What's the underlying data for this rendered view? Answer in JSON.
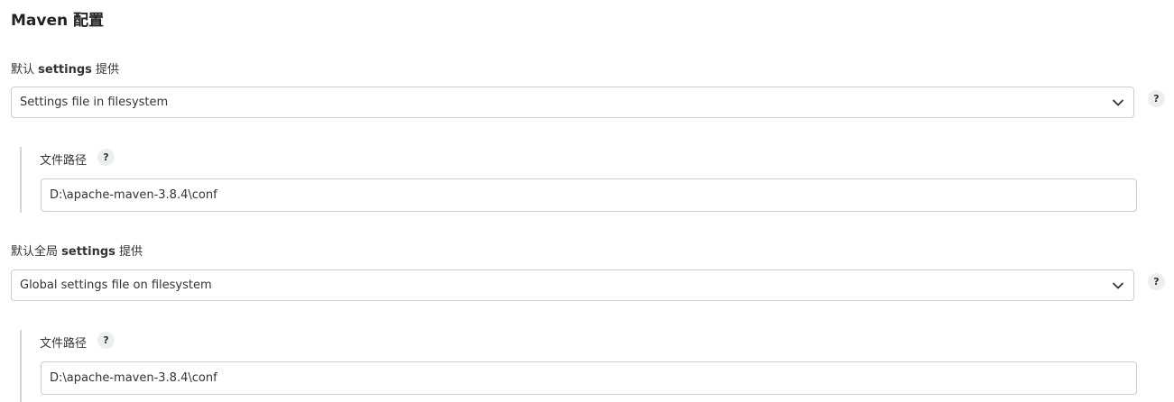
{
  "section": {
    "title": "Maven 配置"
  },
  "settings": {
    "label_prefix": "默认 ",
    "label_bold": "settings",
    "label_suffix": " 提供",
    "selected": "Settings file in filesystem",
    "help_text": "?",
    "file_path": {
      "label": "文件路径",
      "help_text": "?",
      "value": "D:\\apache-maven-3.8.4\\conf"
    }
  },
  "global_settings": {
    "label_prefix": "默认全局 ",
    "label_bold": "settings",
    "label_suffix": " 提供",
    "selected": "Global settings file on filesystem",
    "help_text": "?",
    "file_path": {
      "label": "文件路径",
      "help_text": "?",
      "value": "D:\\apache-maven-3.8.4\\conf"
    }
  }
}
